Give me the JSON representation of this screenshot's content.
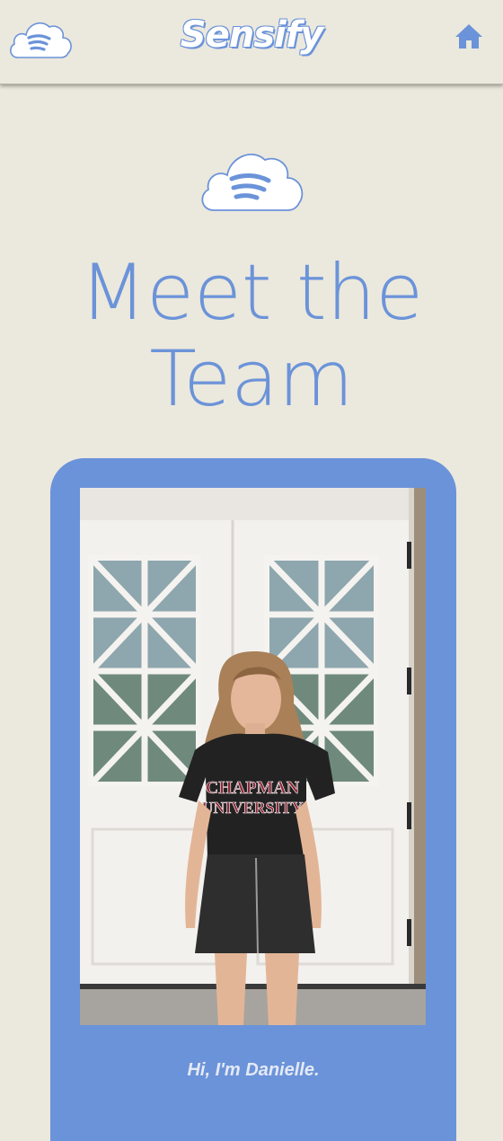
{
  "header": {
    "brand": "Sensify",
    "logo_icon": "cloud-waves-icon",
    "home_icon": "home-icon"
  },
  "hero": {
    "logo_icon": "cloud-waves-icon",
    "title_line1": "Meet the",
    "title_line2": "Team"
  },
  "team_card": {
    "photo_alt": "Danielle standing in front of white double doors",
    "caption": "Hi, I'm Danielle."
  },
  "colors": {
    "background": "#ebe8dd",
    "accent": "#6b93d9",
    "text_light": "#e4e9f5"
  }
}
